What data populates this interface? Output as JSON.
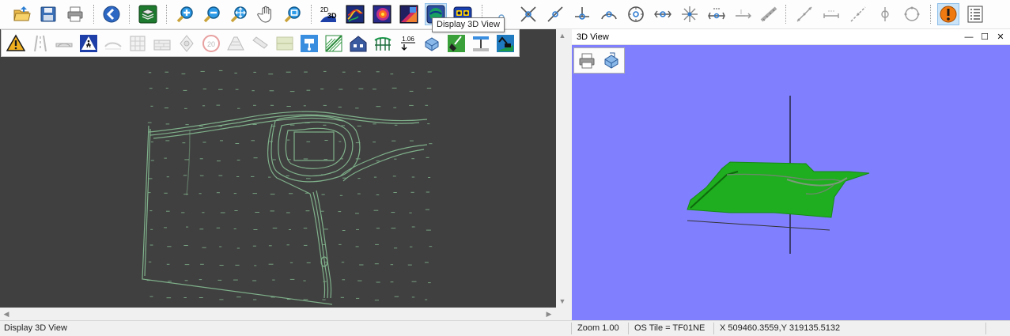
{
  "tooltip": "Display 3D View",
  "view3d": {
    "title": "3D View",
    "minimize_glyph": "—",
    "maximize_glyph": "☐",
    "close_glyph": "✕"
  },
  "toolbar": {
    "label_2d3d_top": "2D",
    "label_2d3d_bottom": "3D"
  },
  "float_toolbar": {
    "level_label": "1.06",
    "speed_label": "20"
  },
  "statusbar": {
    "message": "Display 3D View",
    "zoom": "Zoom 1.00",
    "os_tile": "OS Tile = TF01NE",
    "coords": "X 509460.3559,Y 319135.5132"
  },
  "colors": {
    "plan_background": "#404040",
    "plan_lines": "#7fb08a",
    "view3d_background": "#8080ff",
    "terrain": "#1fae1f",
    "warning_orange": "#f07a12"
  }
}
